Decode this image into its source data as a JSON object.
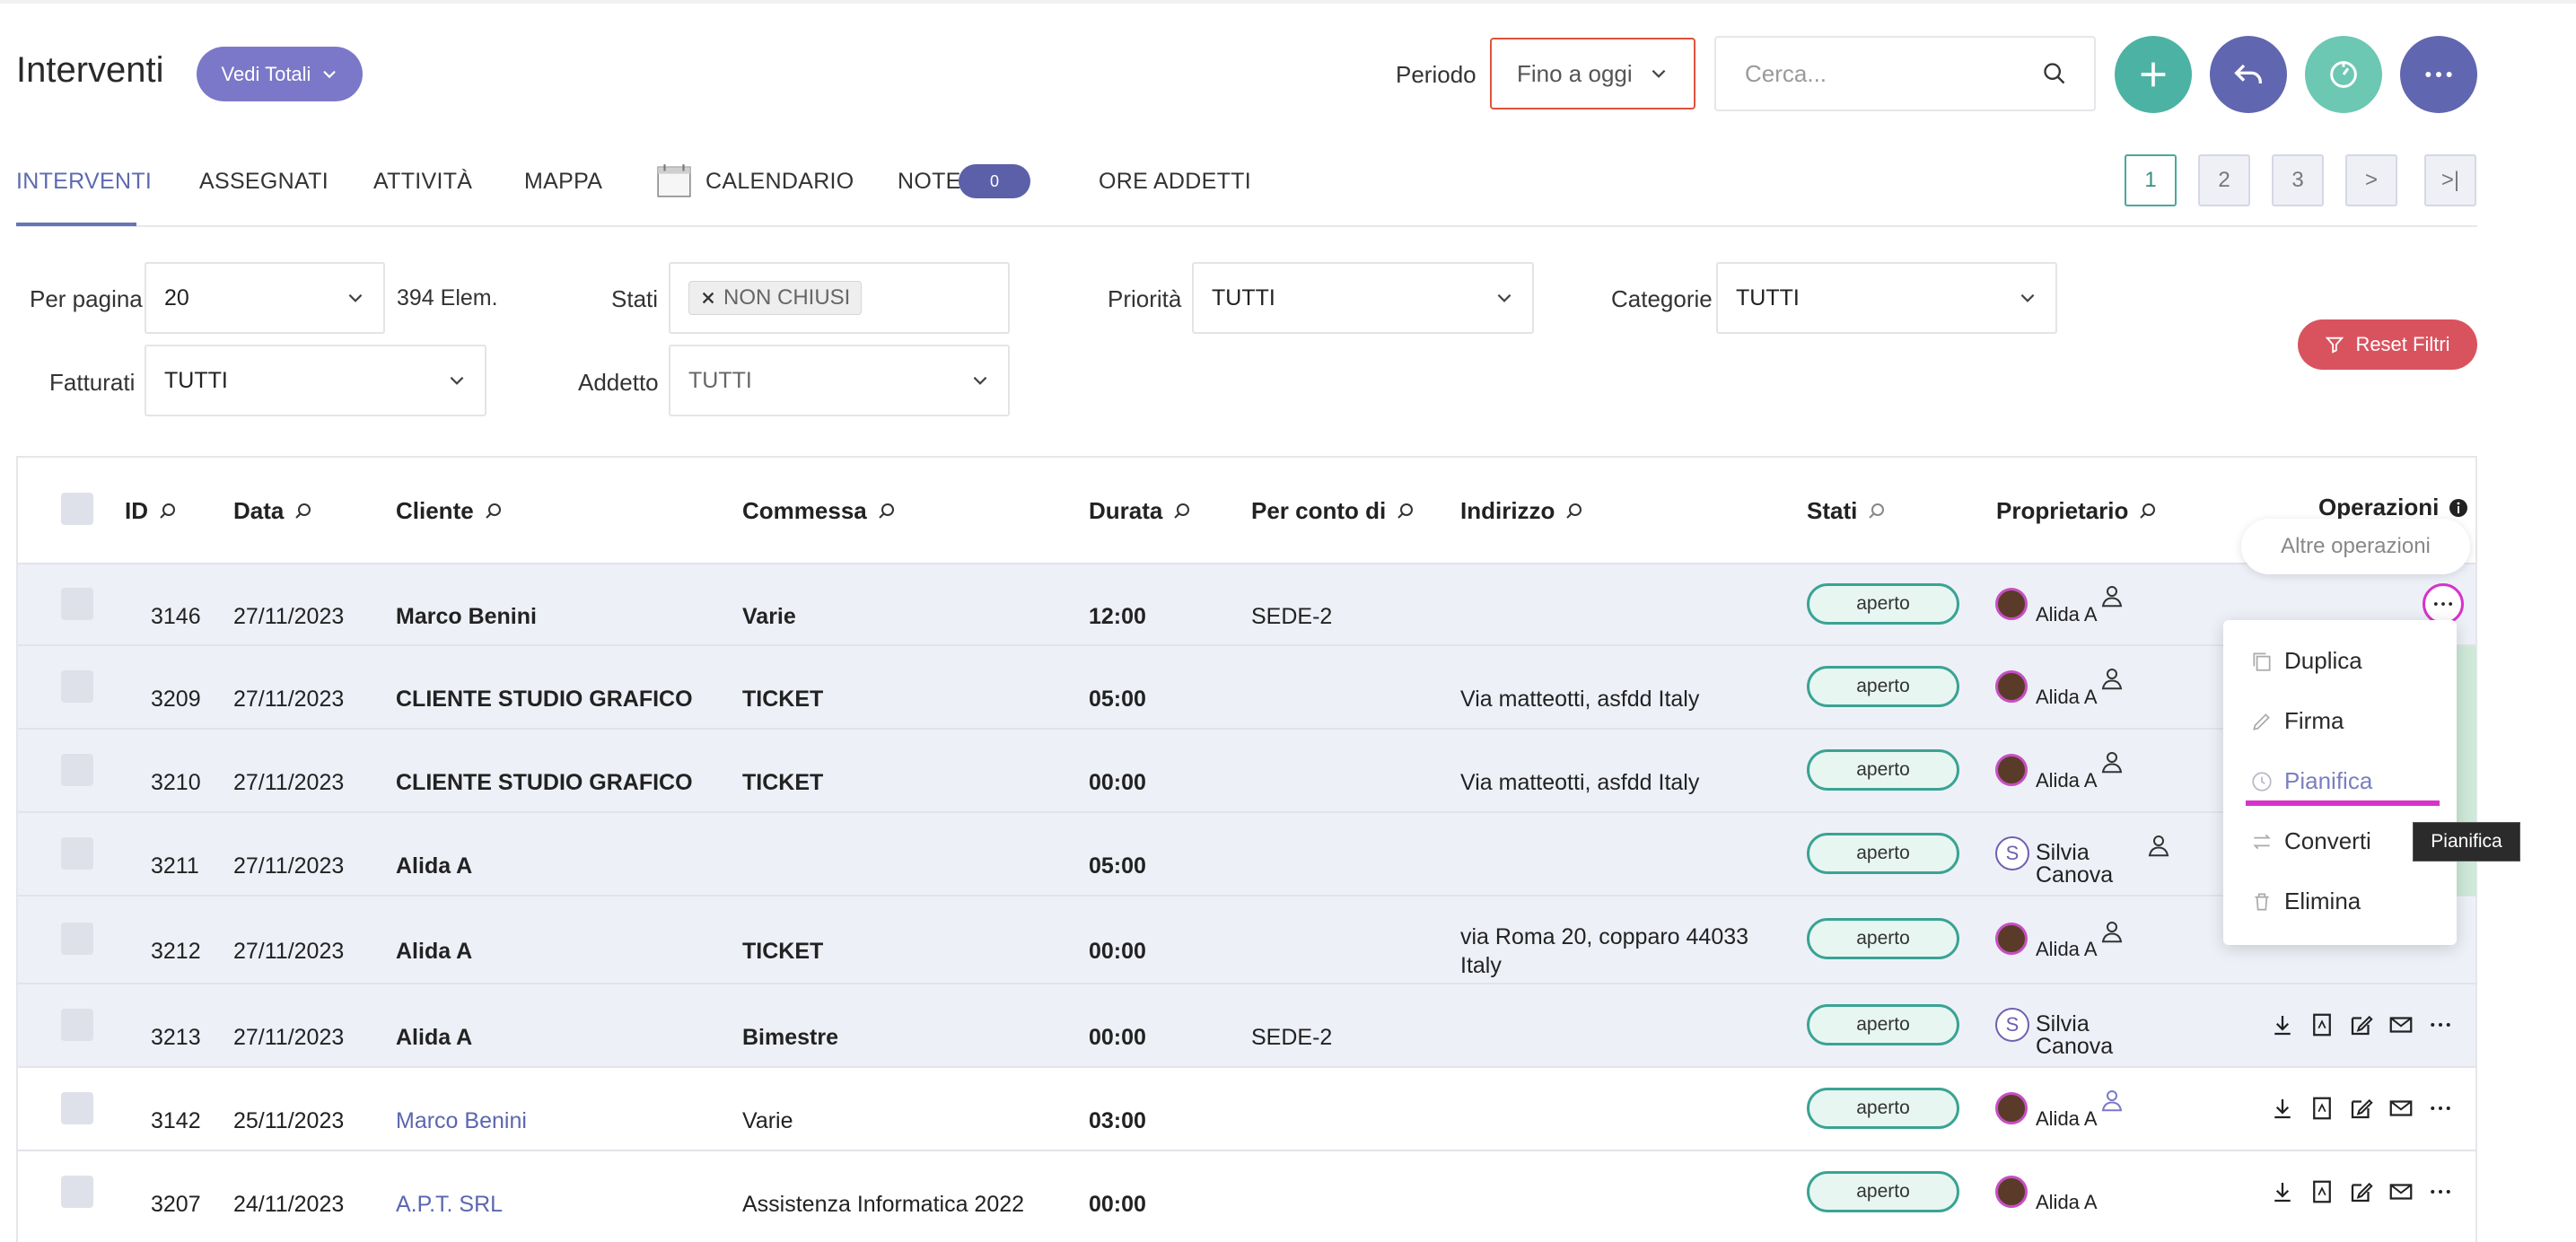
{
  "header": {
    "title": "Interventi",
    "totals_button": "Vedi Totali",
    "periodo_label": "Periodo",
    "periodo_value": "Fino a oggi",
    "search_placeholder": "Cerca..."
  },
  "tabs": {
    "interventi": "INTERVENTI",
    "assegnati": "ASSEGNATI",
    "attivita": "ATTIVITÀ",
    "mappa": "MAPPA",
    "calendario": "CALENDARIO",
    "note": "NOTE",
    "note_count": "0",
    "ore_addetti": "ORE ADDETTI"
  },
  "pagination": {
    "p1": "1",
    "p2": "2",
    "p3": "3",
    "next": ">",
    "last": ">|"
  },
  "filters": {
    "per_pagina_label": "Per pagina",
    "per_pagina_value": "20",
    "count": "394 Elem.",
    "stati_label": "Stati",
    "stati_chip": "NON CHIUSI",
    "priorita_label": "Priorità",
    "priorita_value": "TUTTI",
    "categorie_label": "Categorie",
    "categorie_value": "TUTTI",
    "fatturati_label": "Fatturati",
    "fatturati_value": "TUTTI",
    "addetto_label": "Addetto",
    "addetto_value": "TUTTI",
    "reset_label": "Reset Filtri"
  },
  "table": {
    "headers": {
      "id": "ID",
      "data": "Data",
      "cliente": "Cliente",
      "commessa": "Commessa",
      "durata": "Durata",
      "per_conto_di": "Per conto di",
      "indirizzo": "Indirizzo",
      "stati": "Stati",
      "proprietario": "Proprietario",
      "operazioni": "Operazioni"
    },
    "rows": [
      {
        "id": "3146",
        "data": "27/11/2023",
        "cliente": "Marco Benini",
        "commessa": "Varie",
        "durata": "12:00",
        "per_conto_di": "SEDE-2",
        "indirizzo_1": "",
        "indirizzo_2": "",
        "stato": "aperto",
        "owner_1": "Alida A",
        "owner_2": ""
      },
      {
        "id": "3209",
        "data": "27/11/2023",
        "cliente": "CLIENTE STUDIO GRAFICO",
        "commessa": "TICKET",
        "durata": "05:00",
        "per_conto_di": "",
        "indirizzo_1": "Via matteotti, asfdd Italy",
        "indirizzo_2": "",
        "stato": "aperto",
        "owner_1": "Alida A",
        "owner_2": ""
      },
      {
        "id": "3210",
        "data": "27/11/2023",
        "cliente": "CLIENTE STUDIO GRAFICO",
        "commessa": "TICKET",
        "durata": "00:00",
        "per_conto_di": "",
        "indirizzo_1": "Via matteotti, asfdd Italy",
        "indirizzo_2": "",
        "stato": "aperto",
        "owner_1": "Alida A",
        "owner_2": ""
      },
      {
        "id": "3211",
        "data": "27/11/2023",
        "cliente": "Alida A",
        "commessa": "",
        "durata": "05:00",
        "per_conto_di": "",
        "indirizzo_1": "",
        "indirizzo_2": "",
        "stato": "aperto",
        "owner_1": "Silvia",
        "owner_2": "Canova",
        "initial": "S"
      },
      {
        "id": "3212",
        "data": "27/11/2023",
        "cliente": "Alida A",
        "commessa": "TICKET",
        "durata": "00:00",
        "per_conto_di": "",
        "indirizzo_1": "via Roma 20, copparo 44033",
        "indirizzo_2": "Italy",
        "stato": "aperto",
        "owner_1": "Alida A",
        "owner_2": ""
      },
      {
        "id": "3213",
        "data": "27/11/2023",
        "cliente": "Alida A",
        "commessa": "Bimestre",
        "durata": "00:00",
        "per_conto_di": "SEDE-2",
        "indirizzo_1": "",
        "indirizzo_2": "",
        "stato": "aperto",
        "owner_1": "Silvia",
        "owner_2": "Canova",
        "initial": "S"
      },
      {
        "id": "3142",
        "data": "25/11/2023",
        "cliente": "Marco Benini",
        "commessa": "Varie",
        "durata": "03:00",
        "per_conto_di": "",
        "indirizzo_1": "",
        "indirizzo_2": "",
        "stato": "aperto",
        "owner_1": "Alida A",
        "owner_2": ""
      },
      {
        "id": "3207",
        "data": "24/11/2023",
        "cliente": "A.P.T. SRL",
        "commessa": "Assistenza Informatica 2022",
        "durata": "00:00",
        "per_conto_di": "",
        "indirizzo_1": "",
        "indirizzo_2": "",
        "stato": "aperto",
        "owner_1": "Alida A",
        "owner_2": ""
      }
    ]
  },
  "context_menu": {
    "tooltip_title": "Altre operazioni",
    "items": [
      "Duplica",
      "Firma",
      "Pianifica",
      "Converti",
      "Elimina"
    ],
    "hover_tooltip": "Pianifica"
  },
  "colors": {
    "accent_purple": "#7b78c9",
    "teal": "#4cb3a4",
    "navy_purple": "#6166b0",
    "danger": "#d9535f",
    "status_border": "#3aa393"
  }
}
